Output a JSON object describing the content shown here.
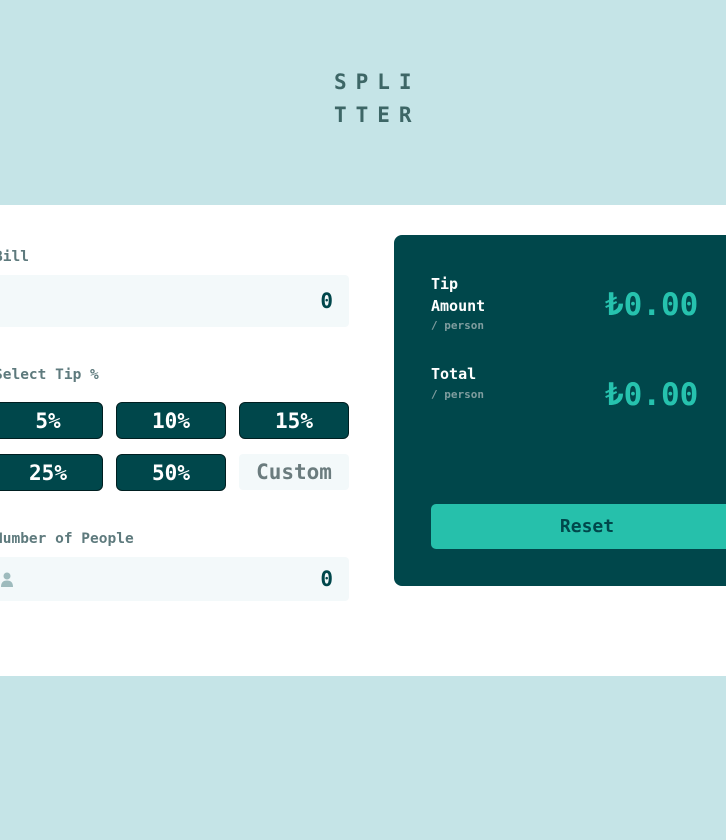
{
  "logo": {
    "line1": "SPLI",
    "line2": "TTER"
  },
  "bill": {
    "label": "Bill",
    "value": "0"
  },
  "tip": {
    "label": "Select Tip %",
    "options": [
      "5%",
      "10%",
      "15%",
      "25%",
      "50%"
    ],
    "custom_placeholder": "Custom"
  },
  "people": {
    "label": "Number of People",
    "value": "0",
    "icon": "person-icon"
  },
  "results": {
    "tip_amount": {
      "title_line1": "Tip",
      "title_line2": "Amount",
      "sub": "/ person",
      "value": "₺0.00"
    },
    "total": {
      "title": "Total",
      "sub": "/ person",
      "value": "₺0.00"
    },
    "reset_label": "Reset"
  },
  "colors": {
    "background": "#c5e4e7",
    "card": "#ffffff",
    "dark_cyan": "#00474b",
    "accent": "#26c2ae",
    "input_bg": "#f3f9fa"
  }
}
